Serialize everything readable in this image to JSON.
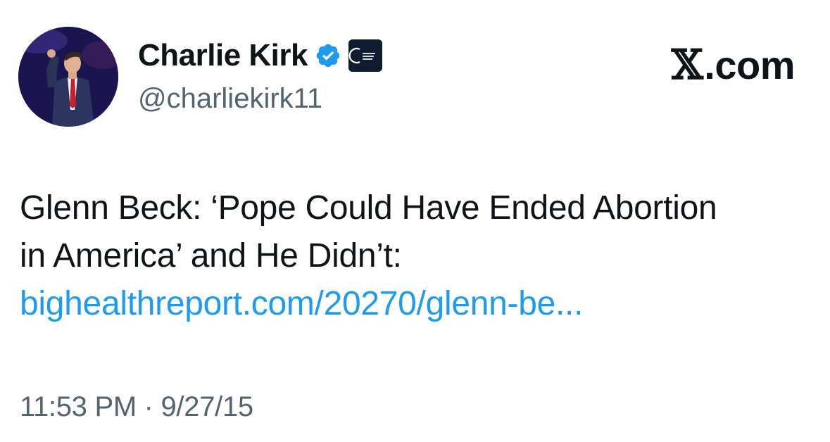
{
  "author": {
    "display_name": "Charlie Kirk",
    "handle": "@charliekirk11",
    "verified_icon": "verified-badge-icon",
    "affiliate_badge_icon": "turning-point-usa-badge",
    "avatar": "profile-photo"
  },
  "brand": {
    "label": ".com",
    "logo_glyph": "𝕏"
  },
  "tweet": {
    "line1": "Glenn Beck: ‘Pope Could Have Ended Abortion",
    "line2": "in America’ and He Didn’t:",
    "link_text": "bighealthreport.com/20270/glenn-be..."
  },
  "meta": {
    "timestamp": "11:53 PM · 9/27/15"
  },
  "colors": {
    "text": "#0f1419",
    "secondary": "#536471",
    "link": "#1d9bf0",
    "verified": "#1d9bf0"
  }
}
